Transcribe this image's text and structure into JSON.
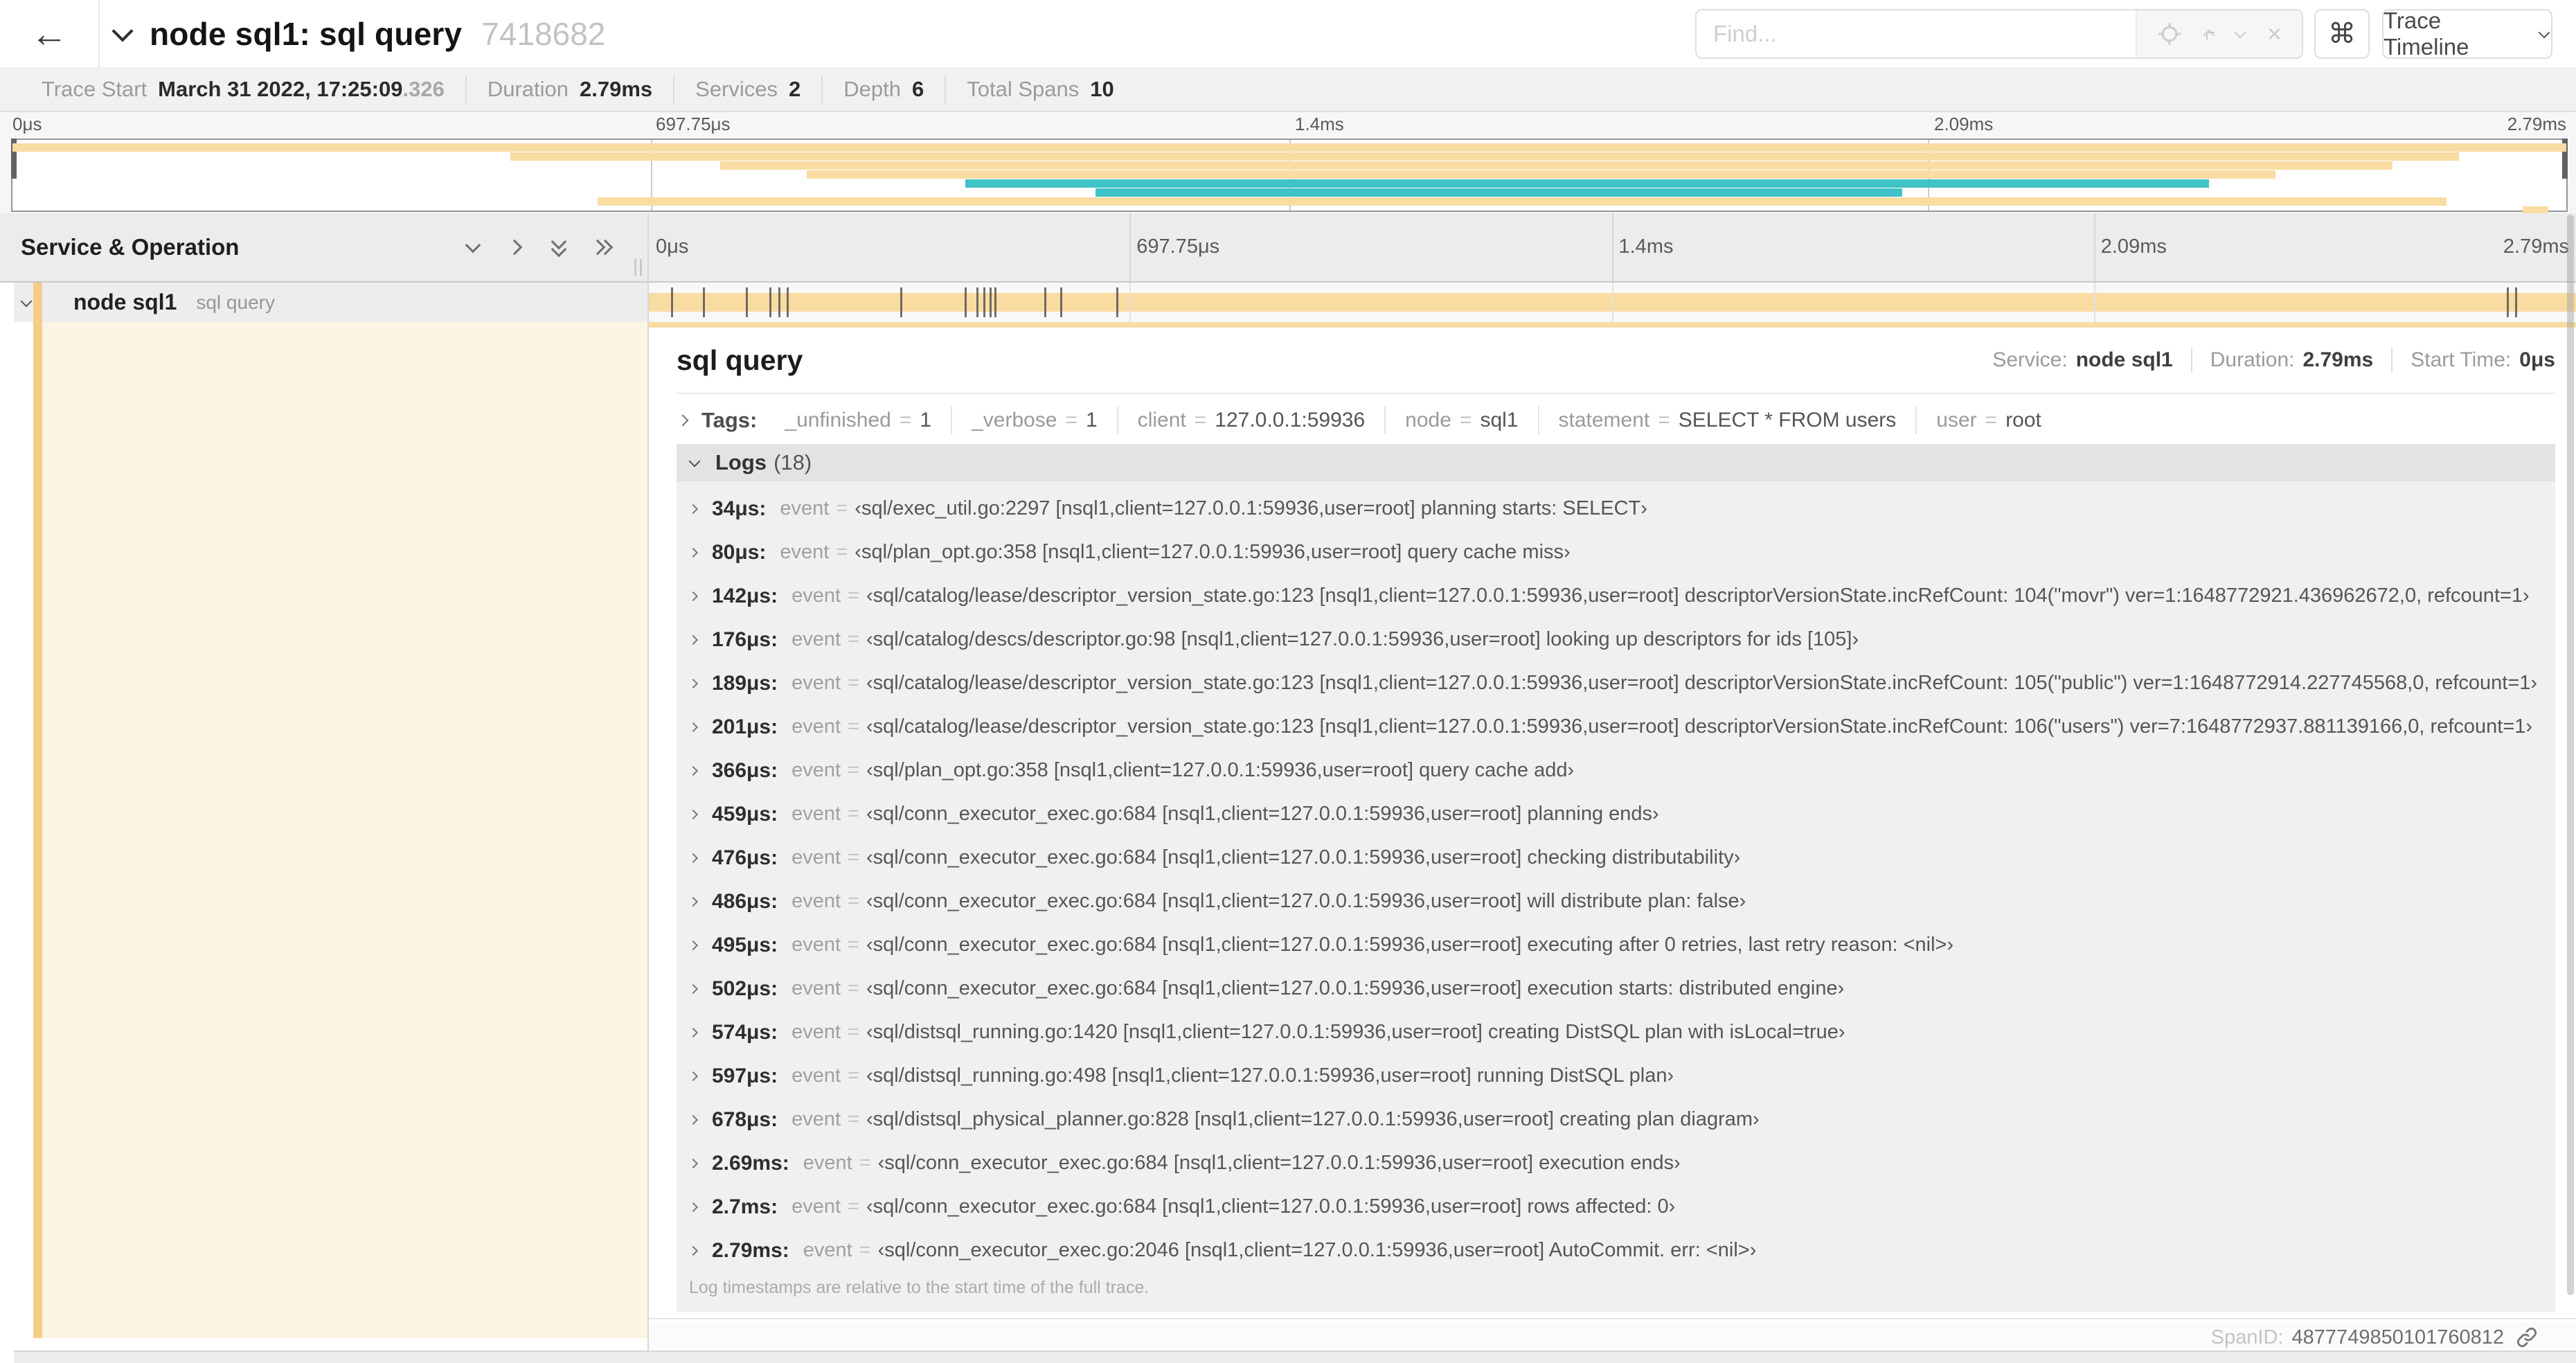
{
  "header": {
    "back_icon": "←",
    "title": "node sql1: sql query",
    "trace_id": "7418682",
    "find_placeholder": "Find...",
    "clear_icon": "×",
    "shortcut_glyph": "⌘",
    "view_selector": "Trace Timeline"
  },
  "summary": {
    "items": [
      {
        "label": "Trace Start",
        "value": "March 31 2022, 17:25:09",
        "suffix": ".326"
      },
      {
        "label": "Duration",
        "value": "2.79ms",
        "suffix": ""
      },
      {
        "label": "Services",
        "value": "2",
        "suffix": ""
      },
      {
        "label": "Depth",
        "value": "6",
        "suffix": ""
      },
      {
        "label": "Total Spans",
        "value": "10",
        "suffix": ""
      }
    ]
  },
  "timeline": {
    "column_header": "Service & Operation",
    "ticks": [
      {
        "label": "0μs",
        "pct": 0
      },
      {
        "label": "697.75μs",
        "pct": 25
      },
      {
        "label": "1.4ms",
        "pct": 50
      },
      {
        "label": "2.09ms",
        "pct": 75
      },
      {
        "label": "2.79ms",
        "pct": 100
      }
    ]
  },
  "minimap": {
    "span_color": "#F8DCA2",
    "rpc_color": "#3FC3C6",
    "spans": [
      {
        "start_pct": 0,
        "end_pct": 100,
        "color": "#F8DCA2"
      },
      {
        "start_pct": 19.5,
        "end_pct": 95.8,
        "color": "#F8DCA2"
      },
      {
        "start_pct": 27.7,
        "end_pct": 93.2,
        "color": "#F8DCA2"
      },
      {
        "start_pct": 31.1,
        "end_pct": 88.6,
        "color": "#F8DCA2"
      },
      {
        "start_pct": 37.3,
        "end_pct": 86.0,
        "color": "#3FC3C6"
      },
      {
        "start_pct": 42.4,
        "end_pct": 74.0,
        "color": "#3FC3C6"
      },
      {
        "start_pct": 22.9,
        "end_pct": 95.3,
        "color": "#F8DCA2"
      },
      {
        "start_pct": 98.3,
        "end_pct": 99.3,
        "color": "#F8DCA2"
      }
    ]
  },
  "span_row": {
    "service": "node sql1",
    "operation": "sql query",
    "bar_color": "#F8DCA2",
    "accent_color": "#F4CD8A",
    "total_us": 2790,
    "log_marks_us": [
      34,
      80,
      142,
      176,
      189,
      201,
      366,
      459,
      476,
      486,
      495,
      502,
      574,
      597,
      678,
      2690,
      2702
    ]
  },
  "detail": {
    "title": "sql query",
    "overview": [
      {
        "label": "Service:",
        "value": "node sql1"
      },
      {
        "label": "Duration:",
        "value": "2.79ms"
      },
      {
        "label": "Start Time:",
        "value": "0μs"
      }
    ],
    "tags_label": "Tags:",
    "tag_eq": "=",
    "tags": [
      {
        "key": "_unfinished",
        "value": "1"
      },
      {
        "key": "_verbose",
        "value": "1"
      },
      {
        "key": "client",
        "value": "127.0.0.1:59936"
      },
      {
        "key": "node",
        "value": "sql1"
      },
      {
        "key": "statement",
        "value": "SELECT * FROM users"
      },
      {
        "key": "user",
        "value": "root"
      }
    ],
    "logs_label": "Logs",
    "logs_count": "(18)",
    "log_key": "event",
    "logs": [
      {
        "time": "34μs:",
        "value": "‹sql/exec_util.go:2297 [nsql1,client=127.0.0.1:59936,user=root] planning starts: SELECT›"
      },
      {
        "time": "80μs:",
        "value": "‹sql/plan_opt.go:358 [nsql1,client=127.0.0.1:59936,user=root] query cache miss›"
      },
      {
        "time": "142μs:",
        "value": "‹sql/catalog/lease/descriptor_version_state.go:123 [nsql1,client=127.0.0.1:59936,user=root] descriptorVersionState.incRefCount: 104(\"movr\") ver=1:1648772921.436962672,0, refcount=1›"
      },
      {
        "time": "176μs:",
        "value": "‹sql/catalog/descs/descriptor.go:98 [nsql1,client=127.0.0.1:59936,user=root] looking up descriptors for ids [105]›"
      },
      {
        "time": "189μs:",
        "value": "‹sql/catalog/lease/descriptor_version_state.go:123 [nsql1,client=127.0.0.1:59936,user=root] descriptorVersionState.incRefCount: 105(\"public\") ver=1:1648772914.227745568,0, refcount=1›"
      },
      {
        "time": "201μs:",
        "value": "‹sql/catalog/lease/descriptor_version_state.go:123 [nsql1,client=127.0.0.1:59936,user=root] descriptorVersionState.incRefCount: 106(\"users\") ver=7:1648772937.881139166,0, refcount=1›"
      },
      {
        "time": "366μs:",
        "value": "‹sql/plan_opt.go:358 [nsql1,client=127.0.0.1:59936,user=root] query cache add›"
      },
      {
        "time": "459μs:",
        "value": "‹sql/conn_executor_exec.go:684 [nsql1,client=127.0.0.1:59936,user=root] planning ends›"
      },
      {
        "time": "476μs:",
        "value": "‹sql/conn_executor_exec.go:684 [nsql1,client=127.0.0.1:59936,user=root] checking distributability›"
      },
      {
        "time": "486μs:",
        "value": "‹sql/conn_executor_exec.go:684 [nsql1,client=127.0.0.1:59936,user=root] will distribute plan: false›"
      },
      {
        "time": "495μs:",
        "value": "‹sql/conn_executor_exec.go:684 [nsql1,client=127.0.0.1:59936,user=root] executing after 0 retries, last retry reason: <nil>›"
      },
      {
        "time": "502μs:",
        "value": "‹sql/conn_executor_exec.go:684 [nsql1,client=127.0.0.1:59936,user=root] execution starts: distributed engine›"
      },
      {
        "time": "574μs:",
        "value": "‹sql/distsql_running.go:1420 [nsql1,client=127.0.0.1:59936,user=root] creating DistSQL plan with isLocal=true›"
      },
      {
        "time": "597μs:",
        "value": "‹sql/distsql_running.go:498 [nsql1,client=127.0.0.1:59936,user=root] running DistSQL plan›"
      },
      {
        "time": "678μs:",
        "value": "‹sql/distsql_physical_planner.go:828 [nsql1,client=127.0.0.1:59936,user=root] creating plan diagram›"
      },
      {
        "time": "2.69ms:",
        "value": "‹sql/conn_executor_exec.go:684 [nsql1,client=127.0.0.1:59936,user=root] execution ends›"
      },
      {
        "time": "2.7ms:",
        "value": "‹sql/conn_executor_exec.go:684 [nsql1,client=127.0.0.1:59936,user=root] rows affected: 0›"
      },
      {
        "time": "2.79ms:",
        "value": "‹sql/conn_executor_exec.go:2046 [nsql1,client=127.0.0.1:59936,user=root] AutoCommit. err: <nil>›"
      }
    ],
    "logs_footer": "Log timestamps are relative to the start time of the full trace.",
    "span_id_label": "SpanID:",
    "span_id": "4877749850101760812"
  }
}
